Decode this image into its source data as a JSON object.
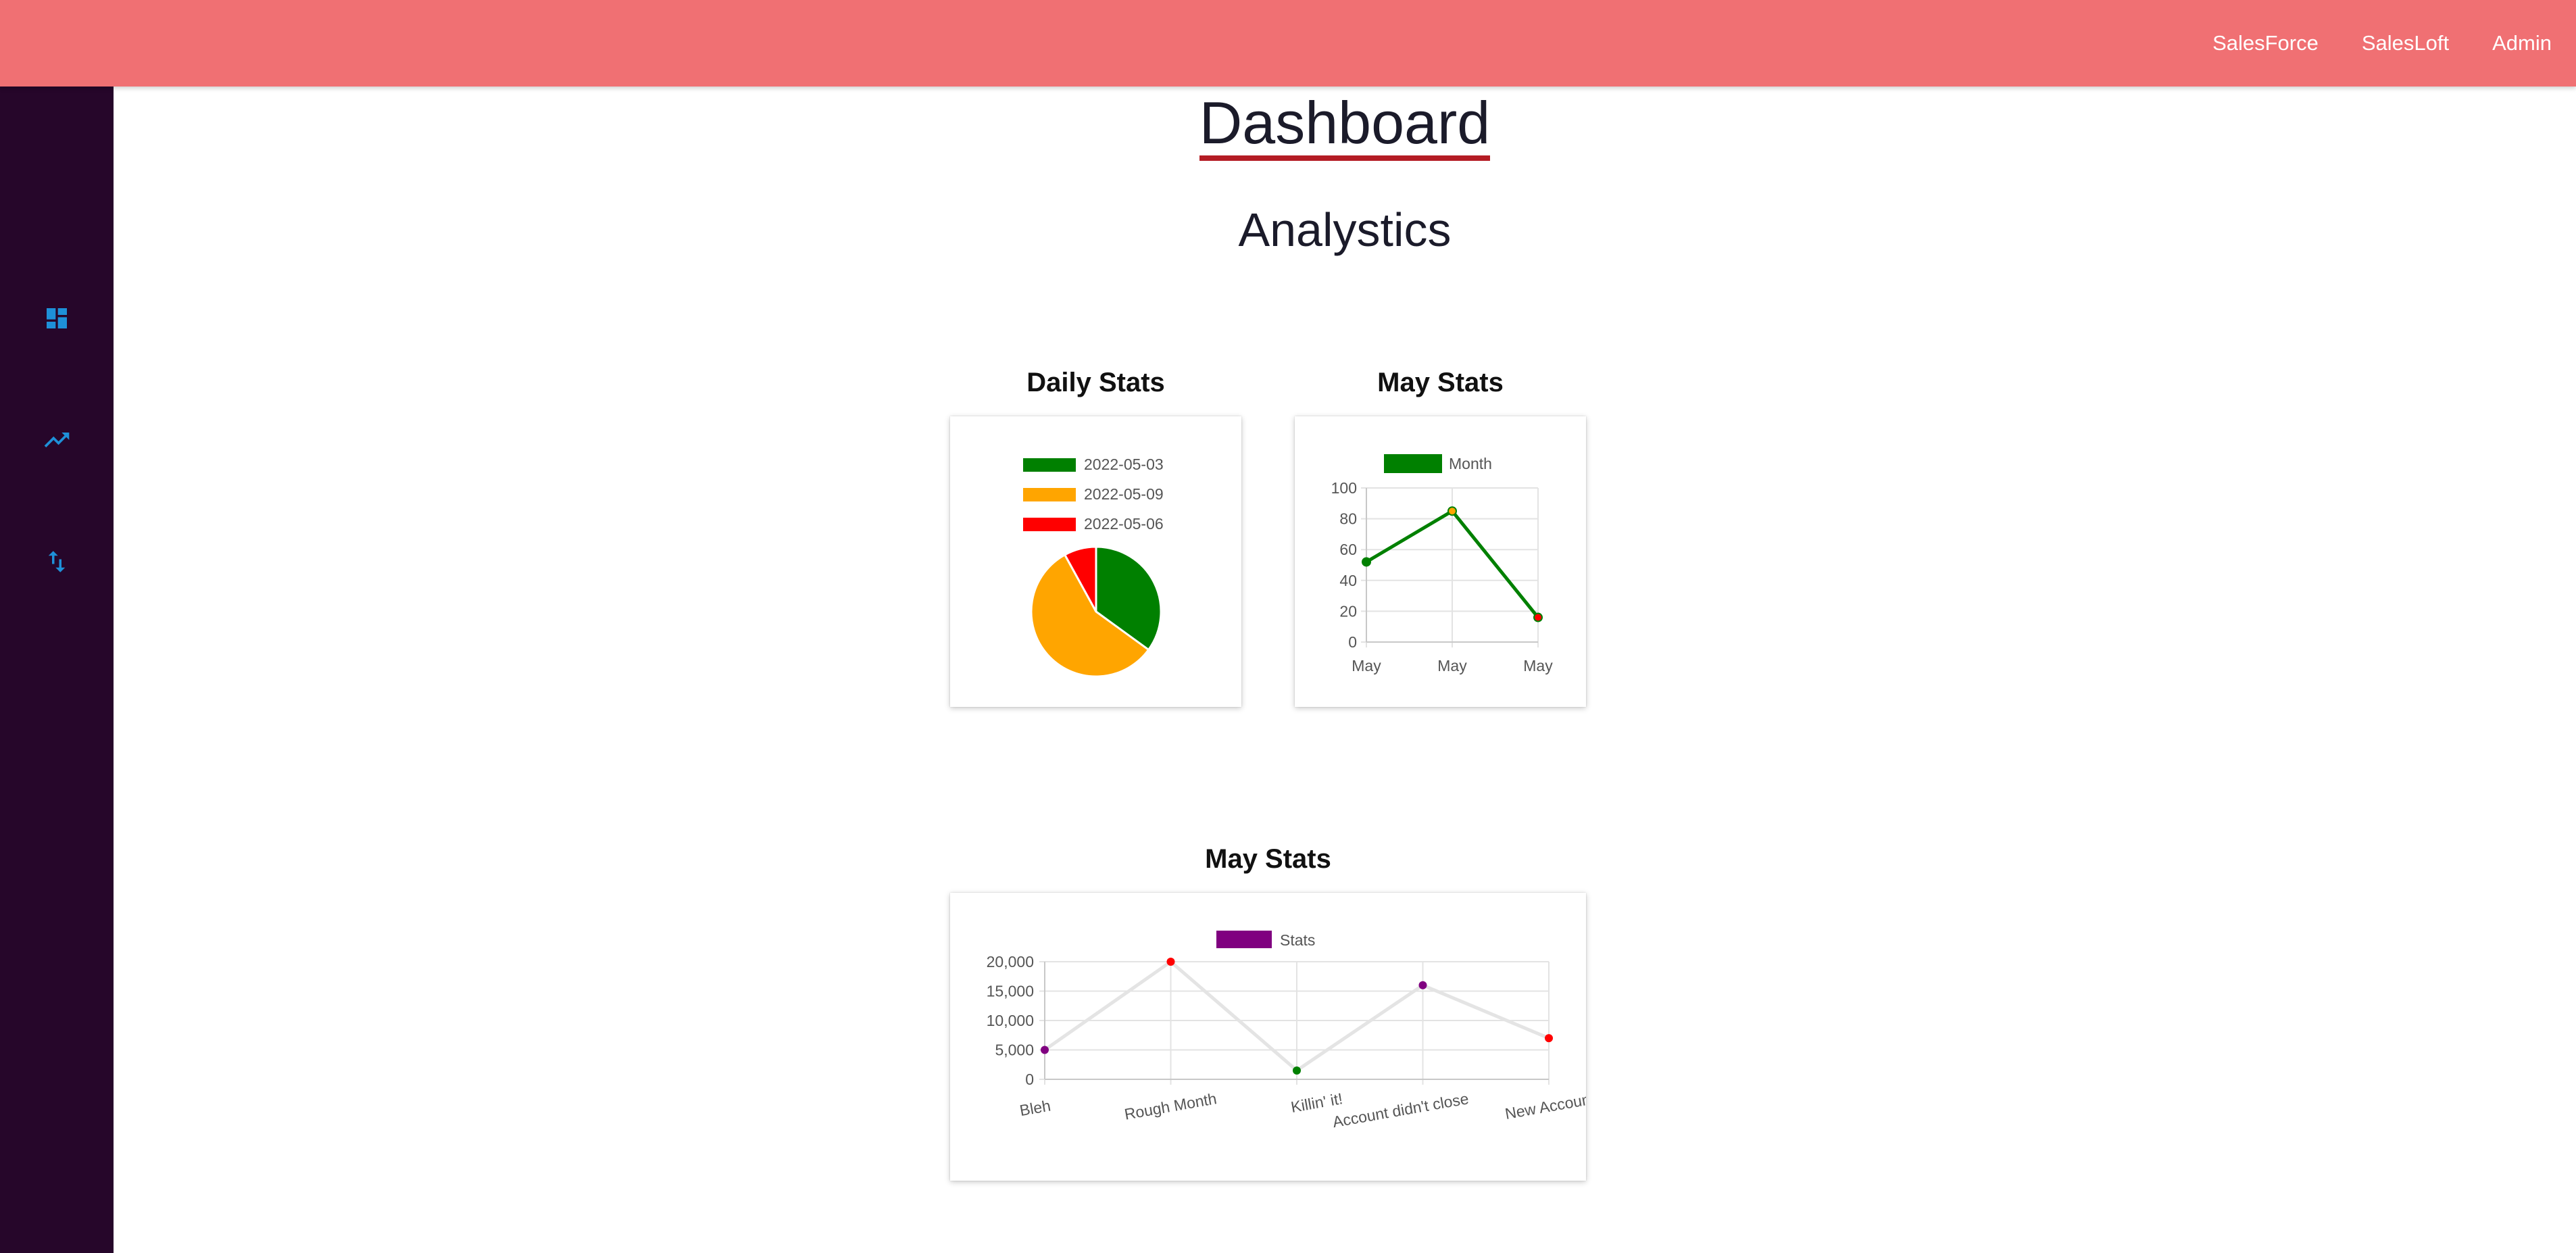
{
  "topnav": {
    "items": [
      {
        "label": "SalesForce"
      },
      {
        "label": "SalesLoft"
      },
      {
        "label": "Admin"
      }
    ]
  },
  "sidebar": {
    "items": [
      {
        "icon": "dashboard-icon",
        "color": "#1e90d8"
      },
      {
        "icon": "trending-up-icon",
        "color": "#1e90d8"
      },
      {
        "icon": "swap-vert-icon",
        "color": "#1e90d8"
      }
    ]
  },
  "main": {
    "title": "Dashboard",
    "subtitle": "Analystics"
  },
  "cards": {
    "daily": {
      "title": "Daily Stats"
    },
    "may": {
      "title": "May Stats"
    },
    "may2": {
      "title": "May Stats"
    }
  },
  "chart_data": [
    {
      "type": "pie",
      "title": "Daily Stats",
      "labels": [
        "2022-05-03",
        "2022-05-09",
        "2022-05-06"
      ],
      "values": [
        35,
        57,
        8
      ],
      "colors": [
        "#008000",
        "#ffa500",
        "#ff0000"
      ],
      "legend": "top"
    },
    {
      "type": "line",
      "title": "May Stats",
      "categories": [
        "May",
        "May",
        "May"
      ],
      "series": [
        {
          "name": "Month",
          "values": [
            52,
            85,
            16
          ],
          "color": "#008000"
        }
      ],
      "point_colors": [
        "#008000",
        "#ffa500",
        "#ff0000"
      ],
      "ylim": [
        0,
        100
      ],
      "yticks": [
        0,
        20,
        40,
        60,
        80,
        100
      ],
      "grid": true,
      "legend": "top"
    },
    {
      "type": "line",
      "title": "May Stats",
      "categories": [
        "Bleh",
        "Rough Month",
        "Killin' it!",
        "Account didn't close",
        "New Account"
      ],
      "series": [
        {
          "name": "Stats",
          "values": [
            5000,
            20000,
            1500,
            16000,
            7000
          ],
          "color": "#800080"
        }
      ],
      "line_color": "#e4e4e4",
      "point_colors": [
        "#800080",
        "#ff0000",
        "#008000",
        "#800080",
        "#ff0000"
      ],
      "ylim": [
        0,
        20000
      ],
      "yticks": [
        "0",
        "5,000",
        "10,000",
        "15,000",
        "20,000"
      ],
      "ytick_values": [
        0,
        5000,
        10000,
        15000,
        20000
      ],
      "grid": true,
      "legend": "top"
    }
  ]
}
